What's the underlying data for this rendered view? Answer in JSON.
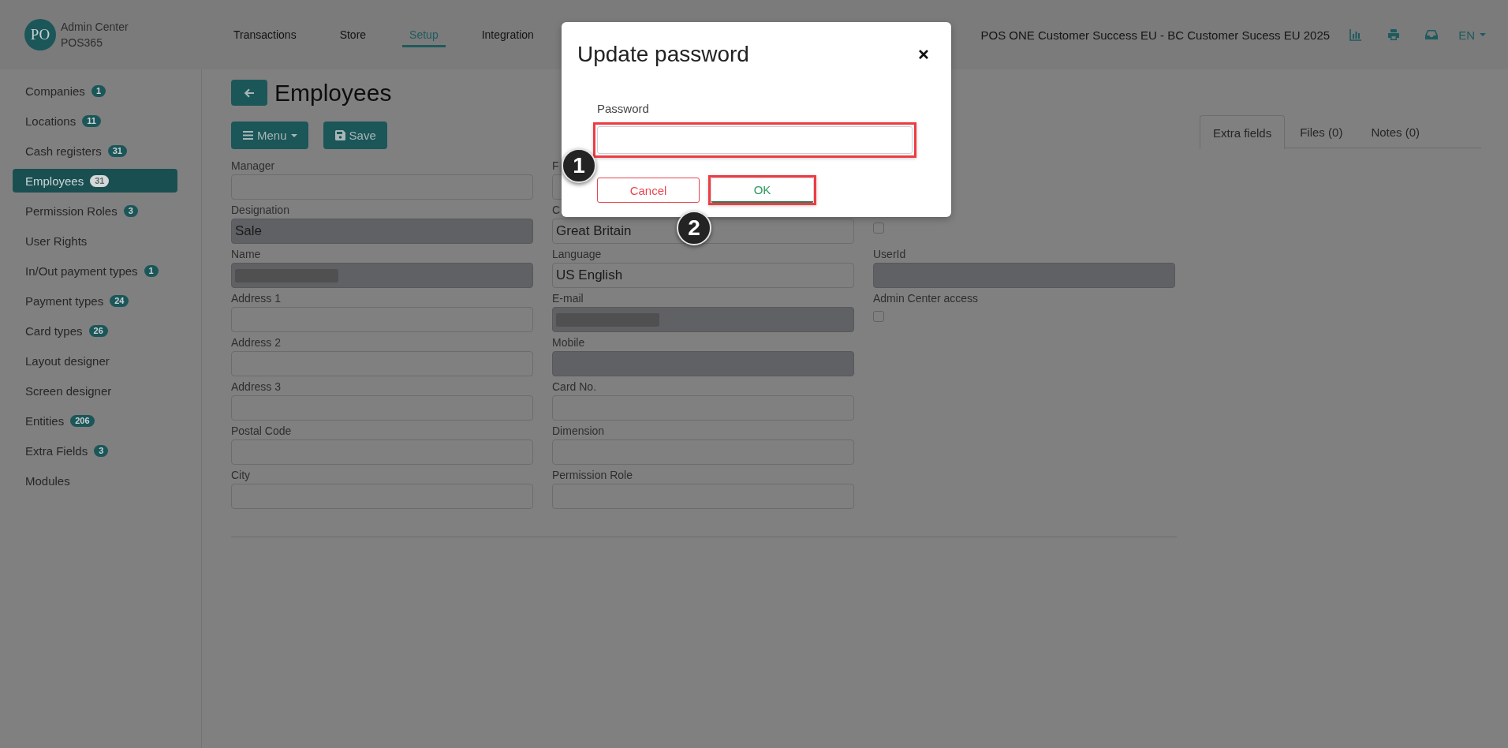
{
  "app": {
    "logo": "PO",
    "title": "Admin Center",
    "subtitle": "POS365"
  },
  "nav": [
    {
      "label": "Transactions",
      "selected": false
    },
    {
      "label": "Store",
      "selected": false
    },
    {
      "label": "Setup",
      "selected": true
    },
    {
      "label": "Integration",
      "selected": false
    }
  ],
  "header_right": {
    "account": "POS ONE Customer Success EU - BC Customer Sucess EU 2025",
    "language": "EN"
  },
  "sidebar": {
    "items": [
      {
        "label": "Companies",
        "count": "1",
        "selected": false
      },
      {
        "label": "Locations",
        "count": "11",
        "selected": false
      },
      {
        "label": "Cash registers",
        "count": "31",
        "selected": false
      },
      {
        "label": "Employees",
        "count": "31",
        "selected": true
      },
      {
        "label": "Permission Roles",
        "count": "3",
        "selected": false
      },
      {
        "label": "User Rights",
        "selected": false
      },
      {
        "label": "In/Out payment types",
        "count": "1",
        "selected": false
      },
      {
        "label": "Payment types",
        "count": "24",
        "selected": false
      },
      {
        "label": "Card types",
        "count": "26",
        "selected": false
      },
      {
        "label": "Layout designer",
        "selected": false
      },
      {
        "label": "Screen designer",
        "selected": false
      },
      {
        "label": "Entities",
        "count": "206",
        "selected": false
      },
      {
        "label": "Extra Fields",
        "count": "3",
        "selected": false
      },
      {
        "label": "Modules",
        "selected": false
      }
    ]
  },
  "page": {
    "title": "Employees",
    "toolbar": [
      {
        "label": "Menu",
        "kind": "menu"
      },
      {
        "label": "Save",
        "kind": "save"
      }
    ]
  },
  "form": {
    "columns": [
      [
        {
          "kind": "text",
          "label": "Manager",
          "readonly": false,
          "redacted": false
        },
        {
          "kind": "text",
          "label": "Designation",
          "value": "Sale",
          "readonly": true,
          "redacted": false
        },
        {
          "kind": "text",
          "label": "Name",
          "readonly": true,
          "redacted": true
        },
        {
          "kind": "text",
          "label": "Address 1",
          "readonly": false,
          "redacted": false
        },
        {
          "kind": "text",
          "label": "Address 2",
          "readonly": false,
          "redacted": false
        },
        {
          "kind": "text",
          "label": "Address 3",
          "readonly": false,
          "redacted": false
        },
        {
          "kind": "text",
          "label": "Postal Code",
          "readonly": false,
          "redacted": false
        },
        {
          "kind": "text",
          "label": "City",
          "readonly": false,
          "redacted": false
        }
      ],
      [
        {
          "kind": "text",
          "label": "F",
          "readonly": false,
          "redacted": false
        },
        {
          "kind": "text",
          "label": "C",
          "value": "Great Britain",
          "readonly": false,
          "redacted": false
        },
        {
          "kind": "text",
          "label": "Language",
          "value": "US English",
          "readonly": false,
          "redacted": false
        },
        {
          "kind": "text",
          "label": "E-mail",
          "readonly": true,
          "redacted": true
        },
        {
          "kind": "text",
          "label": "Mobile",
          "readonly": true,
          "redacted": false
        },
        {
          "kind": "text",
          "label": "Card No.",
          "readonly": false,
          "redacted": false
        },
        {
          "kind": "text",
          "label": "Dimension",
          "readonly": false,
          "redacted": false
        },
        {
          "kind": "text",
          "label": "Permission Role",
          "readonly": false,
          "redacted": false
        }
      ],
      [
        {
          "kind": "checkbox",
          "checked": false
        },
        {
          "kind": "text",
          "label": "UserId",
          "readonly": true,
          "redacted": false
        },
        {
          "kind": "checkbox",
          "label": "Admin Center access",
          "checked": false
        }
      ]
    ]
  },
  "side_tabs": [
    {
      "label": "Extra fields",
      "selected": true
    },
    {
      "label": "Files (0)",
      "selected": false
    },
    {
      "label": "Notes (0)",
      "selected": false
    }
  ],
  "dialog": {
    "title": "Update password",
    "field": {
      "label": "Password",
      "highlighted": true
    },
    "buttons": [
      {
        "label": "Cancel",
        "kind": "cancel",
        "highlighted": false
      },
      {
        "label": "OK",
        "kind": "confirm",
        "highlighted": true
      }
    ],
    "step_badges": [
      {
        "label": "1"
      },
      {
        "label": "2"
      }
    ]
  }
}
